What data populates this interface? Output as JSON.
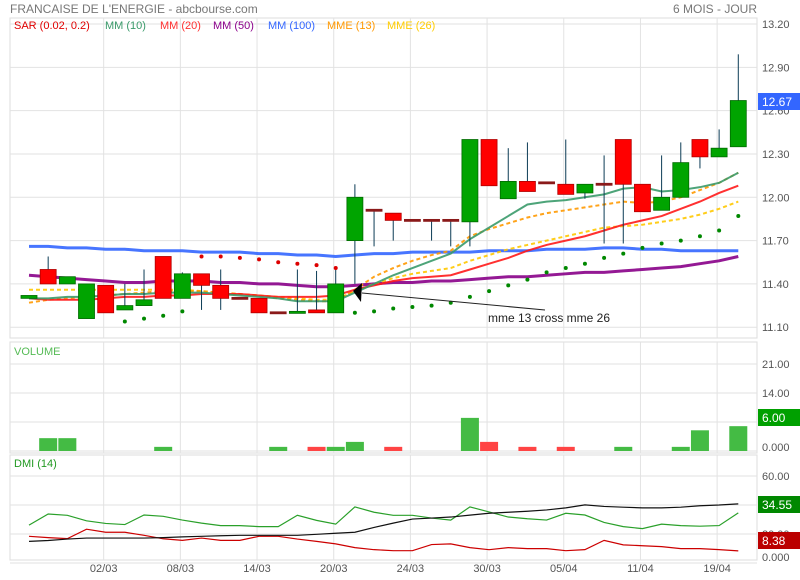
{
  "header": {
    "title": "FRANCAISE DE L'ENERGIE - abcbourse.com",
    "period": "6 MOIS - JOUR"
  },
  "legend": [
    {
      "label": "SAR (0.02, 0.2)",
      "color": "#e00000"
    },
    {
      "label": "MM (10)",
      "color": "#3a9a6a"
    },
    {
      "label": "MM (20)",
      "color": "#ff3030"
    },
    {
      "label": "MM (50)",
      "color": "#8b008b"
    },
    {
      "label": "MM (100)",
      "color": "#3366ff"
    },
    {
      "label": "MME (13)",
      "color": "#ff9900"
    },
    {
      "label": "MME (26)",
      "color": "#ffcc00"
    }
  ],
  "annotation": {
    "text": "mme 13 cross mme 26"
  },
  "chart_data": [
    {
      "type": "candlestick",
      "title": "FRANCAISE DE L'ENERGIE",
      "ylim": [
        11.05,
        13.25
      ],
      "yticks": [
        "13.20",
        "12.90",
        "12.60",
        "12.30",
        "12.00",
        "11.70",
        "11.40",
        "11.10"
      ],
      "last_price_label": "12.67",
      "xticks": [
        {
          "i": 4,
          "label": "02/03"
        },
        {
          "i": 8,
          "label": "08/03"
        },
        {
          "i": 12,
          "label": "14/03"
        },
        {
          "i": 16,
          "label": "20/03"
        },
        {
          "i": 20,
          "label": "24/03"
        },
        {
          "i": 24,
          "label": "30/03"
        },
        {
          "i": 28,
          "label": "05/04"
        },
        {
          "i": 32,
          "label": "11/04"
        },
        {
          "i": 36,
          "label": "19/04"
        }
      ],
      "ohlc": [
        [
          11.3,
          11.32,
          11.3,
          11.32
        ],
        [
          11.5,
          11.59,
          11.4,
          11.4
        ],
        [
          11.4,
          11.45,
          11.4,
          11.45
        ],
        [
          11.16,
          11.4,
          11.16,
          11.4
        ],
        [
          11.39,
          11.39,
          11.2,
          11.2
        ],
        [
          11.22,
          11.4,
          11.22,
          11.25
        ],
        [
          11.25,
          11.5,
          11.25,
          11.29
        ],
        [
          11.59,
          11.59,
          11.3,
          11.3
        ],
        [
          11.3,
          11.48,
          11.3,
          11.47
        ],
        [
          11.47,
          11.47,
          11.22,
          11.39
        ],
        [
          11.39,
          11.5,
          11.22,
          11.3
        ],
        [
          11.3,
          11.3,
          11.3,
          11.3
        ],
        [
          11.3,
          11.3,
          11.2,
          11.2
        ],
        [
          11.2,
          11.2,
          11.2,
          11.2
        ],
        [
          11.2,
          11.5,
          11.2,
          11.21
        ],
        [
          11.22,
          11.49,
          11.2,
          11.2
        ],
        [
          11.2,
          11.5,
          11.2,
          11.4
        ],
        [
          11.7,
          12.09,
          11.4,
          12.0
        ],
        [
          11.91,
          11.91,
          11.66,
          11.91
        ],
        [
          11.89,
          11.89,
          11.7,
          11.84
        ],
        [
          11.84,
          11.84,
          11.84,
          11.84
        ],
        [
          11.84,
          11.84,
          11.7,
          11.84
        ],
        [
          11.84,
          11.84,
          11.66,
          11.84
        ],
        [
          11.83,
          12.4,
          11.66,
          12.4
        ],
        [
          12.4,
          12.4,
          12.08,
          12.08
        ],
        [
          11.99,
          12.34,
          11.99,
          12.11
        ],
        [
          12.11,
          12.38,
          12.04,
          12.04
        ],
        [
          12.1,
          12.1,
          12.1,
          12.1
        ],
        [
          12.09,
          12.4,
          12.02,
          12.02
        ],
        [
          12.03,
          12.09,
          11.99,
          12.09
        ],
        [
          12.09,
          12.29,
          11.68,
          12.09
        ],
        [
          12.4,
          12.4,
          11.68,
          12.09
        ],
        [
          12.09,
          12.09,
          11.9,
          11.9
        ],
        [
          11.91,
          12.29,
          11.91,
          12.0
        ],
        [
          12.0,
          12.38,
          12.0,
          12.24
        ],
        [
          12.4,
          12.4,
          12.2,
          12.28
        ],
        [
          12.28,
          12.47,
          12.28,
          12.34
        ],
        [
          12.35,
          12.99,
          12.35,
          12.67
        ]
      ],
      "sar": [
        null,
        null,
        null,
        null,
        null,
        11.14,
        11.16,
        11.18,
        11.21,
        11.59,
        11.59,
        11.58,
        11.57,
        11.55,
        11.54,
        11.53,
        11.51,
        11.2,
        11.21,
        11.23,
        11.24,
        11.25,
        11.27,
        11.31,
        11.35,
        11.39,
        11.43,
        11.48,
        11.51,
        11.54,
        11.58,
        11.61,
        11.65,
        11.68,
        11.7,
        11.73,
        11.77,
        11.87
      ],
      "series": [
        {
          "name": "MM (100)",
          "values": [
            11.66,
            11.66,
            11.65,
            11.65,
            11.64,
            11.64,
            11.63,
            11.63,
            11.63,
            11.62,
            11.62,
            11.62,
            11.61,
            11.61,
            11.6,
            11.6,
            11.59,
            11.6,
            11.61,
            11.61,
            11.62,
            11.62,
            11.62,
            11.62,
            11.63,
            11.63,
            11.63,
            11.64,
            11.64,
            11.64,
            11.65,
            11.65,
            11.64,
            11.64,
            11.63,
            11.63,
            11.63,
            11.63
          ]
        },
        {
          "name": "MM (50)",
          "values": [
            11.46,
            11.45,
            11.44,
            11.43,
            11.42,
            11.41,
            11.41,
            11.42,
            11.42,
            11.42,
            11.41,
            11.41,
            11.4,
            11.4,
            11.39,
            11.38,
            11.38,
            11.39,
            11.4,
            11.41,
            11.41,
            11.42,
            11.42,
            11.43,
            11.44,
            11.45,
            11.45,
            11.46,
            11.47,
            11.48,
            11.48,
            11.49,
            11.5,
            11.51,
            11.52,
            11.54,
            11.56,
            11.59
          ]
        },
        {
          "name": "MME (26)",
          "values": [
            11.36,
            11.36,
            11.36,
            11.36,
            11.36,
            11.36,
            11.36,
            11.36,
            11.36,
            11.35,
            11.34,
            11.33,
            11.32,
            11.31,
            11.3,
            11.29,
            11.29,
            11.35,
            11.4,
            11.44,
            11.47,
            11.49,
            11.51,
            11.56,
            11.6,
            11.64,
            11.67,
            11.7,
            11.73,
            11.76,
            11.79,
            11.8,
            11.81,
            11.83,
            11.85,
            11.88,
            11.92,
            11.97
          ]
        },
        {
          "name": "MME (13)",
          "values": [
            11.27,
            11.29,
            11.3,
            11.31,
            11.32,
            11.33,
            11.34,
            11.35,
            11.35,
            11.35,
            11.34,
            11.33,
            11.32,
            11.3,
            11.29,
            11.28,
            11.28,
            11.36,
            11.45,
            11.51,
            11.56,
            11.6,
            11.63,
            11.73,
            11.78,
            11.82,
            11.86,
            11.89,
            11.91,
            11.93,
            11.95,
            11.97,
            11.96,
            11.97,
            12.0,
            12.05,
            12.1,
            12.17
          ]
        },
        {
          "name": "MM (20)",
          "values": [
            11.3,
            11.29,
            11.29,
            11.29,
            11.3,
            11.31,
            11.31,
            11.32,
            11.32,
            11.33,
            11.33,
            11.33,
            11.32,
            11.31,
            11.31,
            11.31,
            11.32,
            11.36,
            11.39,
            11.42,
            11.44,
            11.45,
            11.46,
            11.5,
            11.54,
            11.58,
            11.63,
            11.67,
            11.7,
            11.73,
            11.77,
            11.81,
            11.84,
            11.87,
            11.92,
            11.97,
            12.03,
            12.08
          ]
        },
        {
          "name": "MM (10)",
          "values": [
            11.3,
            11.3,
            11.31,
            11.31,
            11.32,
            11.33,
            11.33,
            11.34,
            11.34,
            11.34,
            11.33,
            11.32,
            11.31,
            11.3,
            11.28,
            11.28,
            11.28,
            11.34,
            11.4,
            11.46,
            11.51,
            11.56,
            11.61,
            11.71,
            11.79,
            11.87,
            11.95,
            11.97,
            11.98,
            12.0,
            12.02,
            12.06,
            12.07,
            12.04,
            12.05,
            12.07,
            12.1,
            12.17
          ]
        }
      ]
    },
    {
      "type": "bar",
      "title": "VOLUME",
      "yticks": [
        "21.00",
        "14.00",
        "0.000"
      ],
      "last_label": "6.00",
      "values": [
        0,
        3.1,
        3.1,
        0,
        0,
        0,
        0,
        1.0,
        0,
        0,
        0,
        0,
        0,
        1.0,
        0,
        1.0,
        1.0,
        2.2,
        0,
        1.0,
        0,
        0,
        0,
        8.0,
        2.2,
        0,
        1.0,
        0,
        1.0,
        0,
        0,
        1.0,
        0,
        0,
        1.0,
        5.0,
        0,
        6.0
      ],
      "colors": [
        "g",
        "g",
        "g",
        "g",
        "g",
        "g",
        "g",
        "g",
        "g",
        "g",
        "g",
        "g",
        "g",
        "g",
        "g",
        "r",
        "g",
        "g",
        "g",
        "r",
        "g",
        "g",
        "g",
        "g",
        "r",
        "g",
        "r",
        "g",
        "r",
        "g",
        "g",
        "g",
        "g",
        "g",
        "g",
        "g",
        "g",
        "g"
      ]
    },
    {
      "type": "line",
      "title": "DMI (14)",
      "yticks": [
        "60.00",
        "20.00",
        "0.000"
      ],
      "plus_di_label": "34.55",
      "minus_di_label": "8.38",
      "series": [
        {
          "name": "+DI",
          "color": "#2aa02a",
          "values": [
            26.1,
            33.8,
            32.9,
            29.1,
            27.3,
            26.5,
            33.1,
            32.2,
            29.6,
            27.5,
            25.8,
            25.8,
            25.1,
            25.1,
            32.9,
            29.4,
            26.8,
            38.7,
            35.0,
            32.9,
            32.9,
            31.0,
            29.6,
            38.7,
            35.2,
            31.7,
            30.5,
            29.6,
            34.3,
            33.1,
            28.0,
            25.1,
            23.7,
            26.8,
            25.8,
            25.4,
            25.8,
            34.55
          ]
        },
        {
          "name": "-DI",
          "color": "#cc0000",
          "values": [
            18.4,
            17.5,
            16.8,
            23.3,
            21.2,
            21.2,
            19.1,
            16.7,
            15.6,
            17.2,
            15.6,
            15.6,
            18.4,
            18.4,
            16.5,
            14.9,
            13.2,
            10.6,
            9.2,
            8.5,
            8.5,
            12.7,
            13.2,
            10.6,
            9.2,
            10.6,
            9.9,
            9.9,
            8.5,
            9.2,
            15.6,
            12.5,
            11.9,
            11.3,
            9.9,
            9.9,
            9.2,
            8.38
          ]
        },
        {
          "name": "ADX",
          "color": "#111111",
          "values": [
            14.9,
            15.5,
            16.5,
            17.2,
            17.2,
            17.2,
            17.2,
            17.5,
            18.0,
            18.4,
            18.8,
            19.1,
            19.1,
            19.1,
            19.1,
            19.8,
            20.5,
            21.2,
            24.5,
            27.5,
            30.3,
            31.0,
            31.7,
            33.0,
            34.3,
            35.0,
            35.7,
            36.6,
            38.0,
            40.1,
            39.0,
            38.5,
            38.0,
            38.0,
            38.5,
            39.5,
            40.0,
            40.8
          ]
        }
      ]
    }
  ]
}
